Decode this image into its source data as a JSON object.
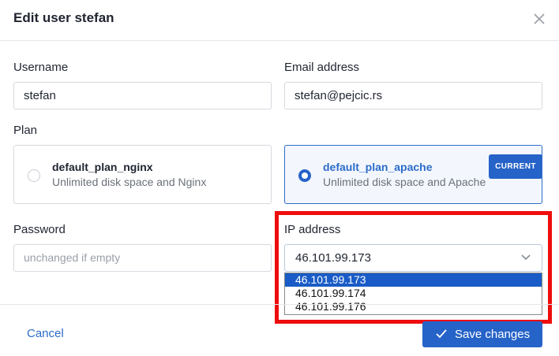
{
  "dialog": {
    "title": "Edit user stefan",
    "close_icon": "close-icon"
  },
  "form": {
    "username": {
      "label": "Username",
      "value": "stefan"
    },
    "email": {
      "label": "Email address",
      "value": "stefan@pejcic.rs"
    },
    "plan": {
      "label": "Plan",
      "options": [
        {
          "name": "default_plan_nginx",
          "description": "Unlimited disk space and Nginx",
          "selected": false
        },
        {
          "name": "default_plan_apache",
          "description": "Unlimited disk space and Apache",
          "selected": true,
          "badge": "CURRENT"
        }
      ]
    },
    "password": {
      "label": "Password",
      "placeholder": "unchanged if empty",
      "value": ""
    },
    "ip": {
      "label": "IP address",
      "value": "46.101.99.173",
      "options": [
        "46.101.99.173",
        "46.101.99.174",
        "46.101.99.176"
      ],
      "highlighted_option": "46.101.99.173"
    }
  },
  "footer": {
    "cancel_label": "Cancel",
    "save_label": "Save changes",
    "save_icon": "check-icon"
  },
  "colors": {
    "accent": "#2663c8",
    "highlight_border": "#ee0d0d"
  }
}
